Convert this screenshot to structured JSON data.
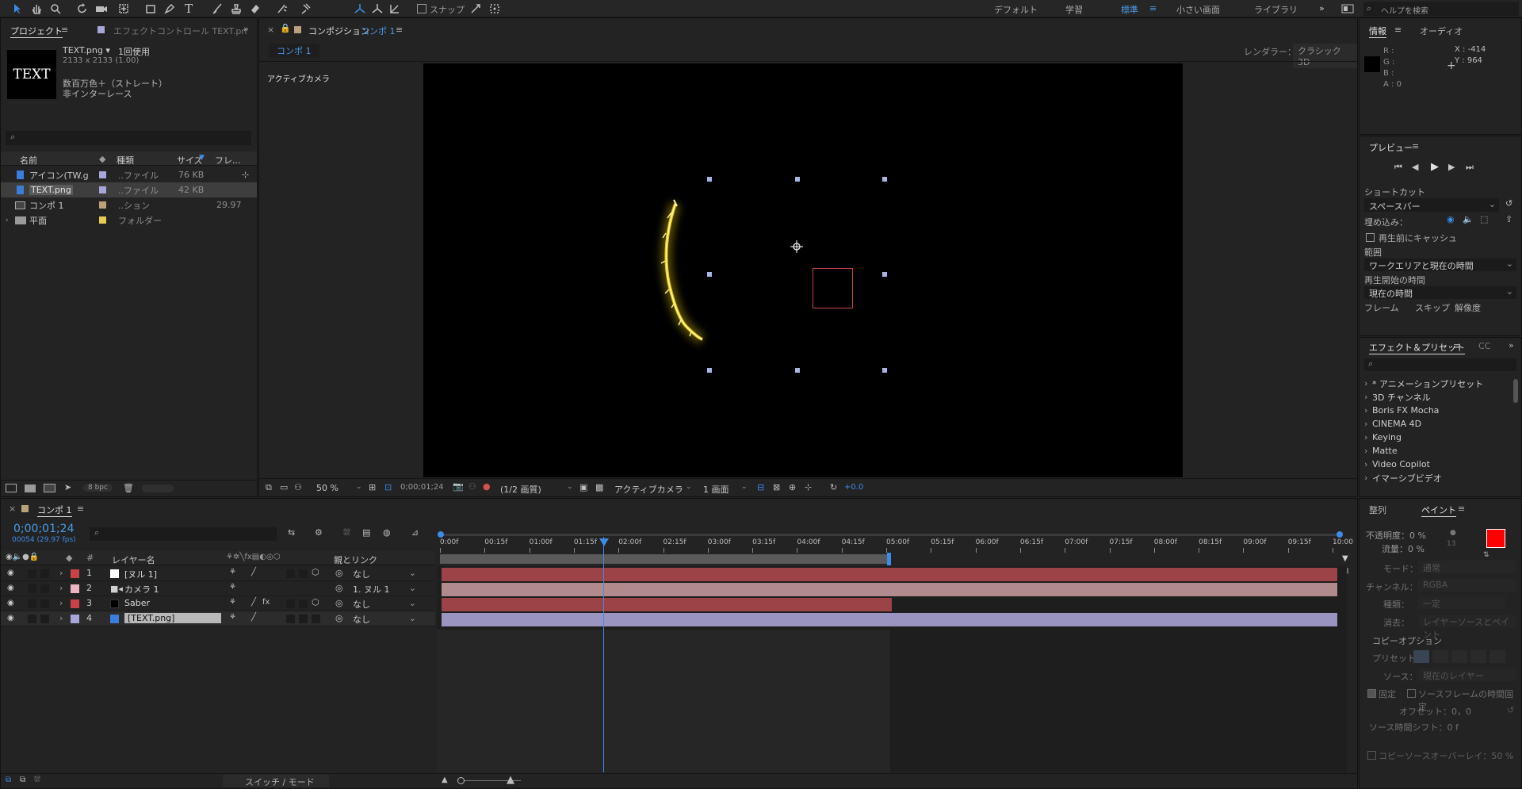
{
  "toolbar": {
    "snap_label": "スナップ",
    "workspaces": [
      "デフォルト",
      "学習",
      "標準",
      "小さい画面",
      "ライブラリ"
    ],
    "active_workspace": "標準",
    "search_placeholder": "ヘルプを検索"
  },
  "project": {
    "tab_project": "プロジェクト",
    "tab_effect": "エフェクトコントロール TEXT.pn",
    "thumb_text": "TEXT",
    "file_name": "TEXT.png ▾",
    "usage": "1回使用",
    "dims": "2133 x 2133 (1.00)",
    "color": "数百万色＋（ストレート）",
    "interlace": "非インターレース",
    "columns": {
      "name": "名前",
      "type": "種類",
      "size": "サイズ",
      "frame": "フレ..."
    },
    "items": [
      {
        "name": "アイコン(TW.g",
        "type": "..ファイル",
        "size": "76 KB",
        "frame": "",
        "color": "#a6a6d8"
      },
      {
        "name": "TEXT.png",
        "type": "..ファイル",
        "size": "42 KB",
        "frame": "",
        "color": "#a6a6d8"
      },
      {
        "name": "コンポ 1",
        "type": "..ション",
        "size": "",
        "frame": "29.97",
        "color": "#b9a27a"
      },
      {
        "name": "平面",
        "type": "フォルダー",
        "size": "",
        "frame": "",
        "color": "#e3cd52"
      }
    ],
    "bpc": "8 bpc"
  },
  "comp": {
    "tab": "コンポジション",
    "tab_name": "コンポ 1",
    "subtab": "コンポ 1",
    "renderer_label": "レンダラー：",
    "renderer": "クラシック3D",
    "camera_label": "アクティブカメラ",
    "zoom": "50 %",
    "timecode": "0;00;01;24",
    "resolution": "(1/2 画質)",
    "view_camera": "アクティブカメラ",
    "view_layout": "1 画面",
    "exposure": "+0.0"
  },
  "info": {
    "tab_info": "情報",
    "tab_audio": "オーディオ",
    "r": "R :",
    "g": "G :",
    "b": "B :",
    "a": "A : 0",
    "x": "X : -414",
    "y": "Y : 964"
  },
  "preview": {
    "title": "プレビュー",
    "shortcut_label": "ショートカット",
    "shortcut": "スペースバー",
    "embed_label": "埋め込み：",
    "cache_label": "再生前にキャッシュ",
    "range_label": "範囲",
    "range": "ワークエリアと現在の時間",
    "start_label": "再生開始の時間",
    "start": "現在の時間",
    "frame": "フレーム",
    "skip": "スキップ",
    "res": "解像度"
  },
  "effects": {
    "tab": "エフェクト＆プリセット",
    "tab_cc": "CC",
    "items": [
      "* アニメーションプリセット",
      "3D チャンネル",
      "Boris FX Mocha",
      "CINEMA 4D",
      "Keying",
      "Matte",
      "Video Copilot",
      "イマーシブビデオ"
    ]
  },
  "paint": {
    "tab_align": "整列",
    "tab_paint": "ペイント",
    "opacity": "不透明度：0 %",
    "flow": "流量：0 %",
    "mode": "モード：",
    "mode_val": "通常",
    "channel": "チャンネル：",
    "channel_val": "RGBA",
    "kind": "種類：",
    "kind_val": "一定",
    "erase": "消去：",
    "erase_val": "レイヤーソースとペイント",
    "copy_opt": "コピーオプション",
    "preset": "プリセット：",
    "source": "ソース：",
    "source_val": "現在のレイヤー",
    "align": "固定",
    "lock": "ソースフレームの時間固定",
    "offset": "オフセット：0，0",
    "shift": "ソース時間シフト：0 f",
    "overlay": "コピーソースオーバーレイ：50 %",
    "brush": "13",
    "fg_color": "#ff0000"
  },
  "timeline": {
    "tab": "コンポ 1",
    "timecode": "0;00;01;24",
    "fps": "00054 (29.97 fps)",
    "header_name": "レイヤー名",
    "header_parent": "親とリンク",
    "ruler": [
      "0:00f",
      "00:15f",
      "01:00f",
      "01:15f",
      "02:00f",
      "02:15f",
      "03:00f",
      "03:15f",
      "04:00f",
      "04:15f",
      "05:00f",
      "05:15f",
      "06:00f",
      "06:15f",
      "07:00f",
      "07:15f",
      "08:00f",
      "08:15f",
      "09:00f",
      "09:15f",
      "10:00"
    ],
    "layers": [
      {
        "num": "1",
        "name": "[ヌル 1]",
        "parent": "なし",
        "color": "#c94247"
      },
      {
        "num": "2",
        "name": "カメラ 1",
        "parent": "1. ヌル 1",
        "color": "#e9b5c3"
      },
      {
        "num": "3",
        "name": "Saber",
        "parent": "なし",
        "color": "#c94247"
      },
      {
        "num": "4",
        "name": "[TEXT.png]",
        "parent": "なし",
        "color": "#a6a6d8"
      }
    ],
    "switch_mode": "スイッチ / モード"
  }
}
